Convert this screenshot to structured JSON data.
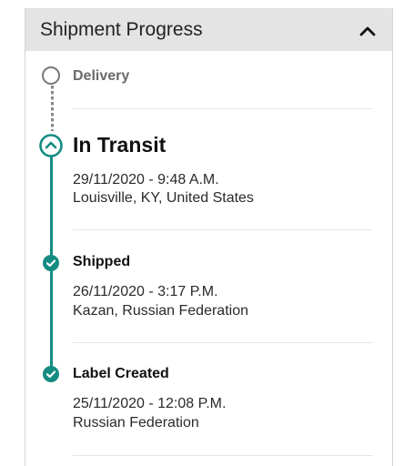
{
  "header": {
    "title": "Shipment Progress",
    "chevron_icon": "chevron-up-icon"
  },
  "colors": {
    "accent": "#148c82",
    "header_bg": "#e4e4e4",
    "pending": "#7a7a7a"
  },
  "timeline": [
    {
      "status": "Delivery",
      "state": "pending"
    },
    {
      "status": "In Transit",
      "state": "current",
      "datetime": "29/11/2020 - 9:48 A.M.",
      "location": "Louisville, KY, United States"
    },
    {
      "status": "Shipped",
      "state": "done",
      "datetime": "26/11/2020 - 3:17 P.M.",
      "location": "Kazan, Russian Federation"
    },
    {
      "status": "Label Created",
      "state": "done",
      "datetime": "25/11/2020 - 12:08 P.M.",
      "location": "Russian Federation"
    }
  ]
}
